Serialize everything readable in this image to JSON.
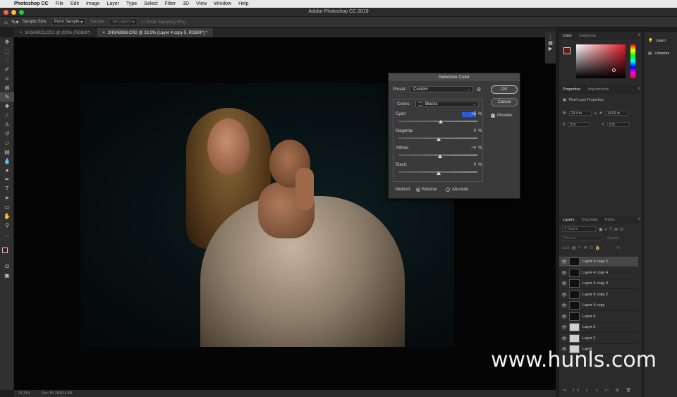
{
  "menubar": {
    "app_name": "Photoshop CC",
    "items": [
      "File",
      "Edit",
      "Image",
      "Layer",
      "Type",
      "Select",
      "Filter",
      "3D",
      "View",
      "Window",
      "Help"
    ]
  },
  "window": {
    "title": "Adobe Photoshop CC 2019"
  },
  "options": {
    "sample_size_label": "Sample Size:",
    "sample_size_value": "Point Sample",
    "sample_label": "Sample:",
    "sample_value": "All Layers",
    "show_ring": "Show Sampling Ring"
  },
  "tabs": [
    {
      "label": "2H3A9023.CR2 @ 200% (RGB/8*)",
      "active": false
    },
    {
      "label": "2H3A9068.CR2 @ 33.3% (Layer 4 copy 5, RGB/8*) *",
      "active": true
    }
  ],
  "status": {
    "zoom": "33.33%",
    "doc": "Doc: 85.1M/814.8M"
  },
  "dialog": {
    "title": "Selective Color",
    "preset_label": "Preset:",
    "preset_value": "Custom",
    "colors_label": "Colors:",
    "colors_value": "Blacks",
    "ok": "OK",
    "cancel": "Cancel",
    "preview": "Preview",
    "sliders": [
      {
        "label": "Cyan:",
        "value": "+5",
        "pct": "%"
      },
      {
        "label": "Magenta:",
        "value": "0",
        "pct": "%"
      },
      {
        "label": "Yellow:",
        "value": "+4",
        "pct": "%"
      },
      {
        "label": "Black:",
        "value": "0",
        "pct": "%"
      }
    ],
    "method_label": "Method:",
    "method_relative": "Relative",
    "method_absolute": "Absolute"
  },
  "panels": {
    "color_tab": "Color",
    "swatches_tab": "Swatches",
    "properties_tab": "Properties",
    "adjustments_tab": "Adjustments",
    "pixel_layer_props": "Pixel Layer Properties",
    "prop_w": "23.4 in",
    "prop_h": "14.63 in",
    "prop_x": "0 in",
    "prop_y": "0 in",
    "layers_tab": "Layers",
    "channels_tab": "Channels",
    "paths_tab": "Paths",
    "kind_label": "Kind",
    "blend_mode": "Normal",
    "opacity_label": "Opacity:",
    "lock_label": "Lock:",
    "fill_label": "Fill:",
    "layers": [
      {
        "name": "Layer 4 copy 5",
        "selected": true,
        "thumb": "photo"
      },
      {
        "name": "Layer 4 copy 4",
        "selected": false,
        "thumb": "photo"
      },
      {
        "name": "Layer 4 copy 3",
        "selected": false,
        "thumb": "photo"
      },
      {
        "name": "Layer 4 copy 2",
        "selected": false,
        "thumb": "photo"
      },
      {
        "name": "Layer 4 copy",
        "selected": false,
        "thumb": "photo"
      },
      {
        "name": "Layer 4",
        "selected": false,
        "thumb": "photo"
      },
      {
        "name": "Layer 3",
        "selected": false,
        "thumb": "light"
      },
      {
        "name": "Layer 2",
        "selected": false,
        "thumb": "light"
      },
      {
        "name": "Layer",
        "selected": false,
        "thumb": "light"
      }
    ]
  },
  "learn": {
    "learn": "Learn",
    "libraries": "Libraries"
  },
  "watermark": "www.hunls.com",
  "colors": {
    "fg": "#6a1a1a",
    "bg": "#ffffff",
    "accent": "#e21a2c"
  }
}
